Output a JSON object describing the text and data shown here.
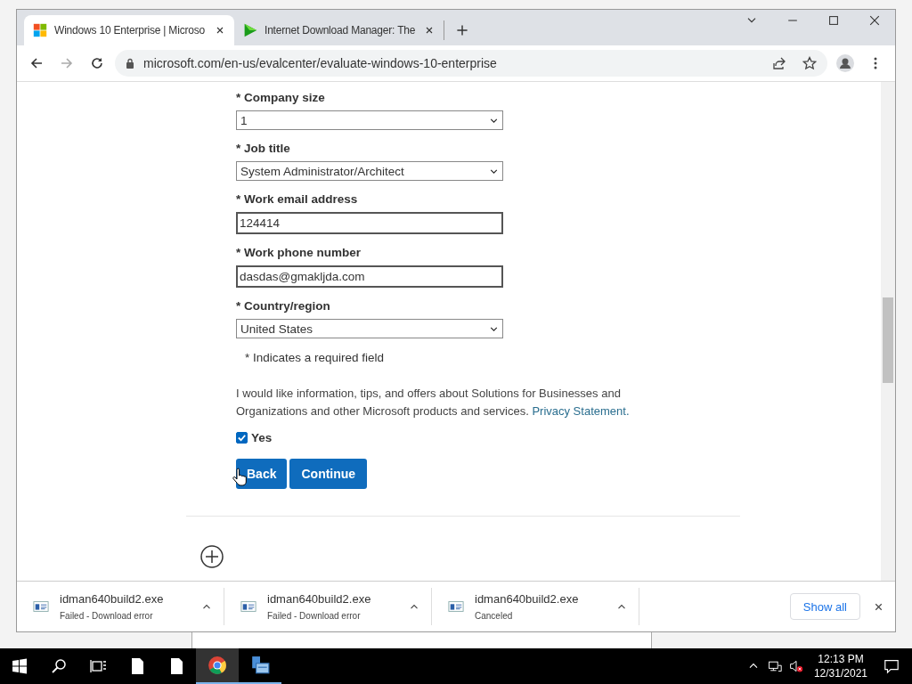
{
  "browser": {
    "tabs": [
      {
        "title": "Windows 10 Enterprise | Microso",
        "kind": "windows",
        "selected": true
      },
      {
        "title": "Internet Download Manager: The",
        "kind": "play",
        "selected": false
      }
    ],
    "address": "microsoft.com/en-us/evalcenter/evaluate-windows-10-enterprise"
  },
  "form": {
    "fields": [
      {
        "label": "* Company size",
        "kind": "select",
        "value": "1"
      },
      {
        "label": "* Job title",
        "kind": "select",
        "value": "System Administrator/Architect"
      },
      {
        "label": "* Work email address",
        "kind": "text",
        "value": "124414"
      },
      {
        "label": "* Work phone number",
        "kind": "text",
        "value": "dasdas@gmakljda.com"
      },
      {
        "label": "* Country/region",
        "kind": "select",
        "value": "United States"
      }
    ],
    "required_note": "* Indicates a required field",
    "consent_text": "I would like information, tips, and offers about Solutions for Businesses and Organizations and other Microsoft products and services. ",
    "privacy_link": "Privacy Statement.",
    "consent": {
      "label": "Yes",
      "checked": true
    },
    "buttons": [
      "Back",
      "Continue"
    ]
  },
  "downloads": [
    {
      "file": "idman640build2.exe",
      "status": "Failed - Download error"
    },
    {
      "file": "idman640build2.exe",
      "status": "Failed - Download error"
    },
    {
      "file": "idman640build2.exe",
      "status": "Canceled"
    }
  ],
  "show_all": "Show all",
  "taskbar": {
    "time": "12:13 PM",
    "date": "12/31/2021"
  }
}
